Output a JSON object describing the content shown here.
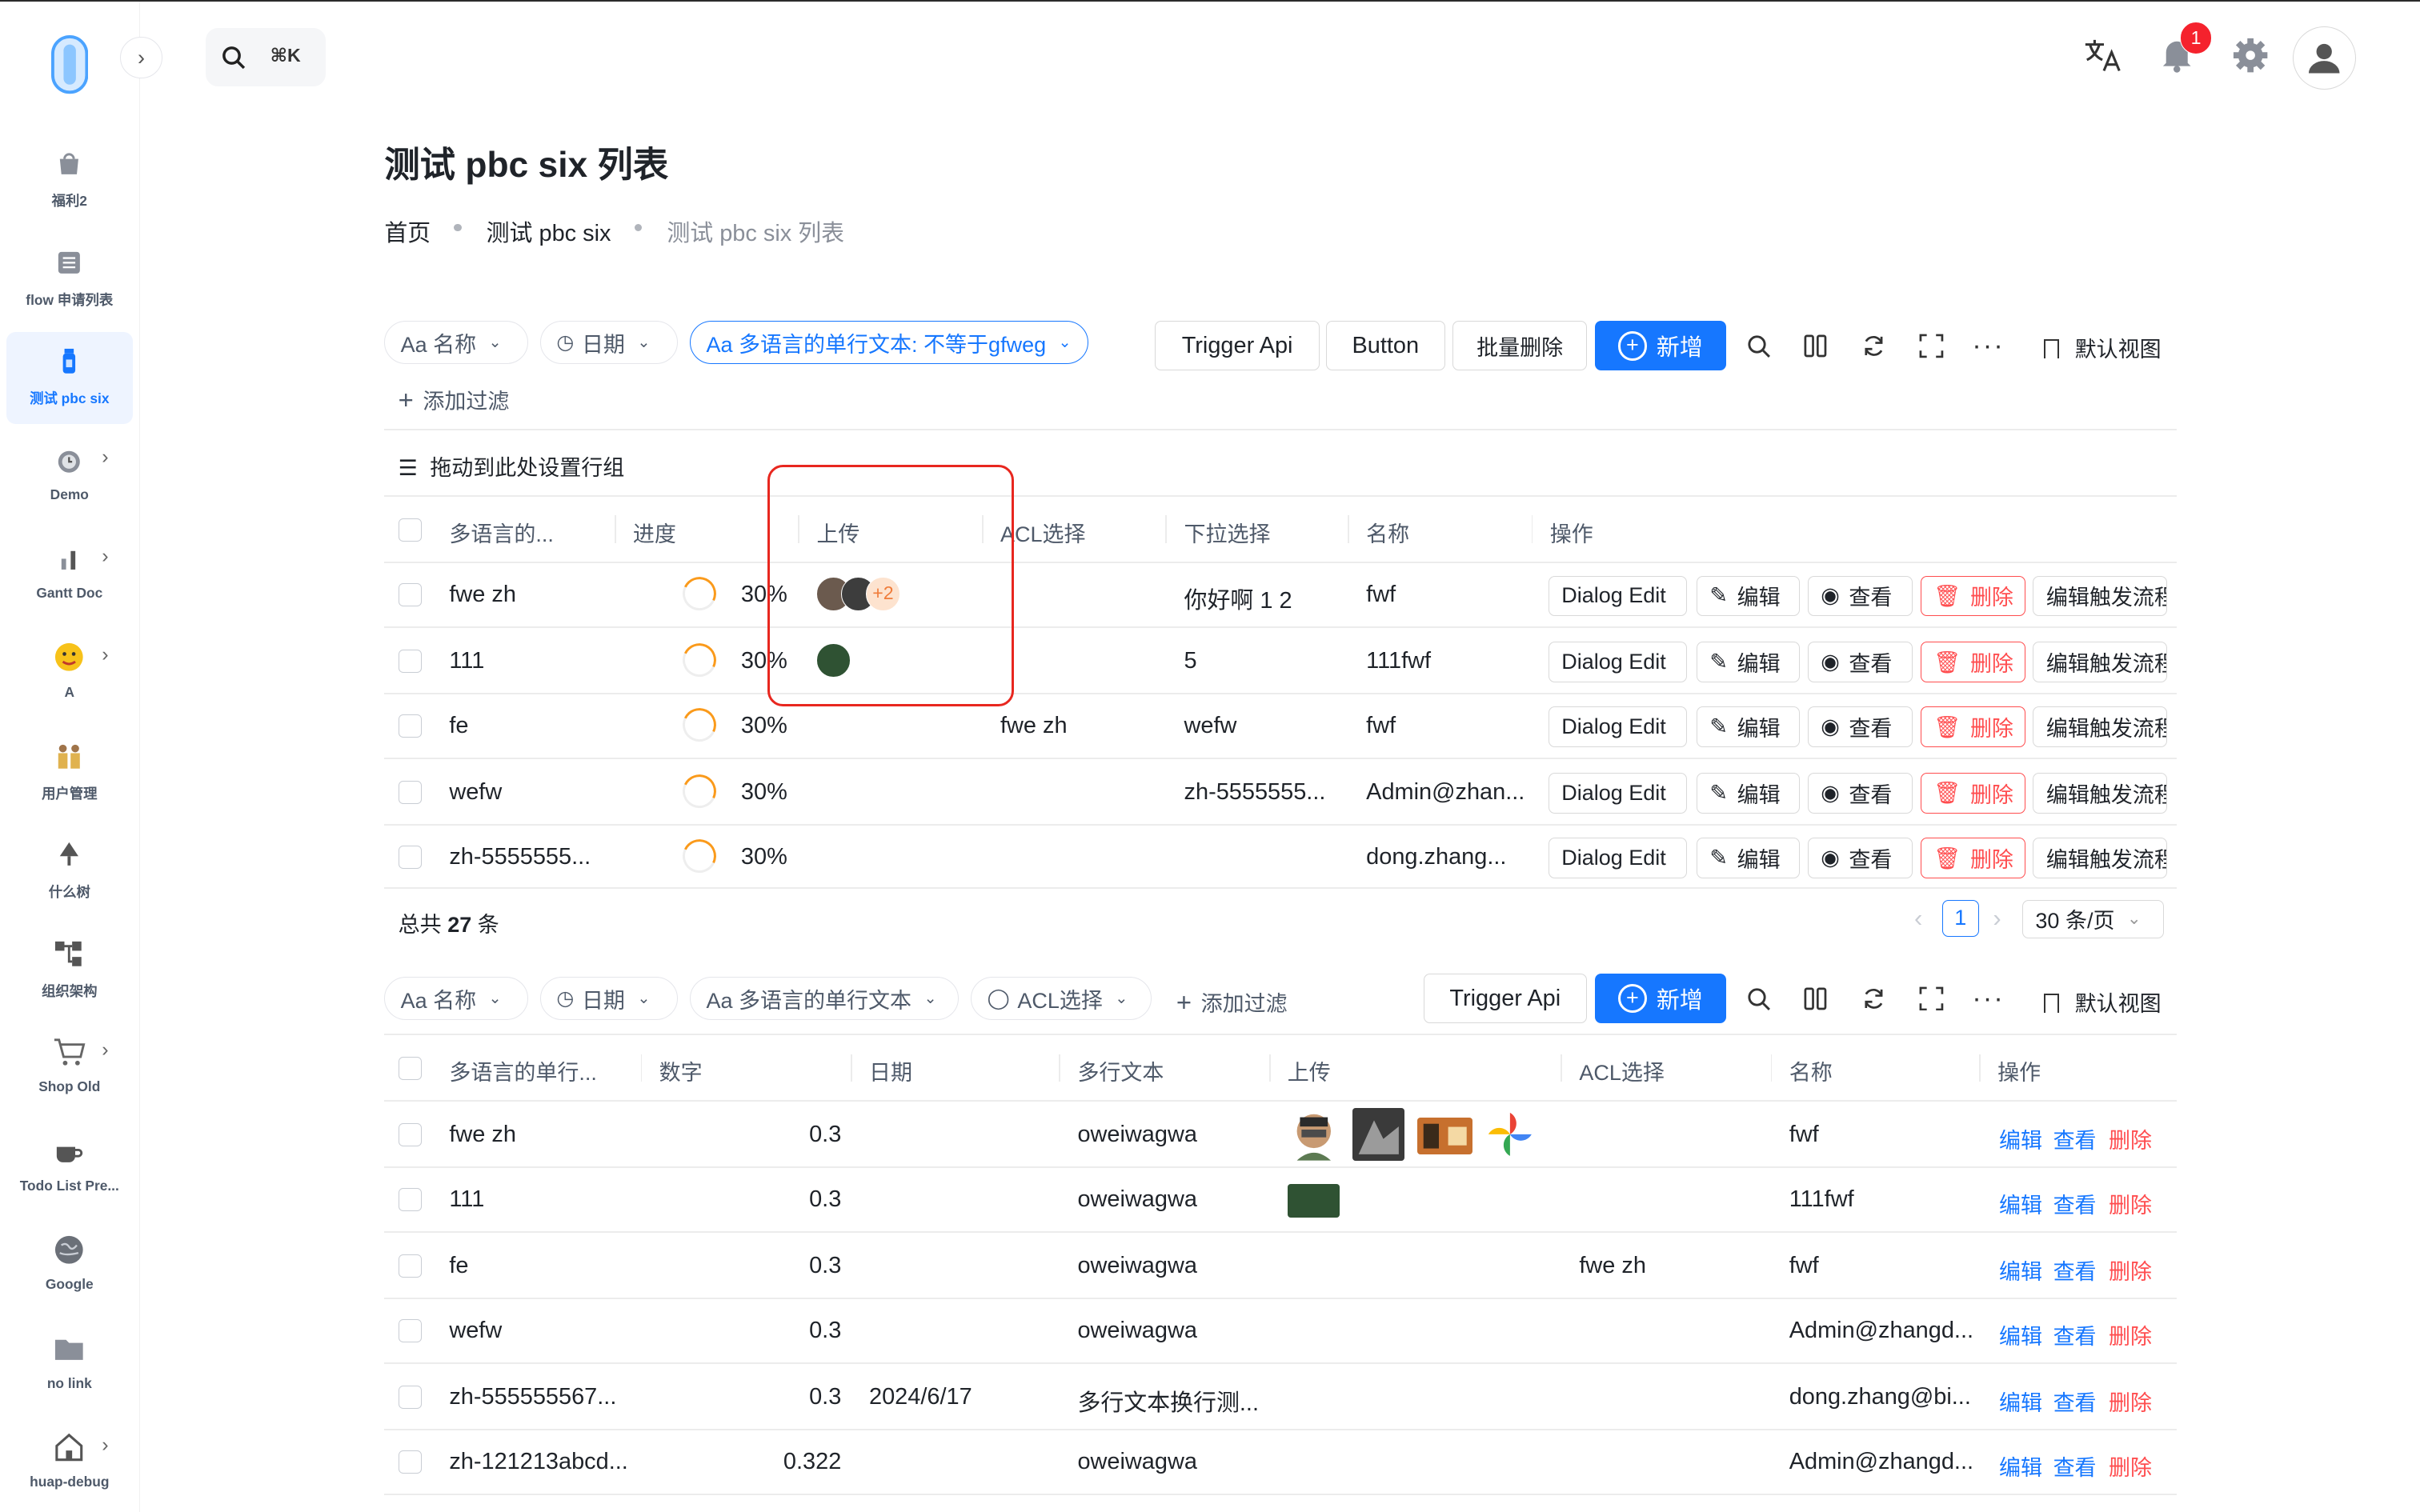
{
  "search": {
    "shortcut": "⌘K"
  },
  "topbar": {
    "notification_count": "1"
  },
  "sidebar": {
    "items": [
      {
        "label": "福利2"
      },
      {
        "label": "flow 申请列表"
      },
      {
        "label": "测试 pbc six"
      },
      {
        "label": "Demo"
      },
      {
        "label": "Gantt Doc"
      },
      {
        "label": "A"
      },
      {
        "label": "用户管理"
      },
      {
        "label": "什么树"
      },
      {
        "label": "组织架构"
      },
      {
        "label": "Shop Old"
      },
      {
        "label": "Todo List Pre..."
      },
      {
        "label": "Google"
      },
      {
        "label": "no link"
      },
      {
        "label": "huap-debug"
      }
    ]
  },
  "page": {
    "title": "测试 pbc six 列表"
  },
  "breadcrumb": [
    "首页",
    "测试 pbc six",
    "测试 pbc six 列表"
  ],
  "table1": {
    "filters": [
      "Aa 名称",
      "日期",
      "Aa 多语言的单行文本: 不等于gfweg"
    ],
    "add_filter": "添加过滤",
    "buttons": {
      "trigger": "Trigger Api",
      "button": "Button",
      "batch_delete": "批量删除",
      "add": "新增",
      "view": "默认视图"
    },
    "group_hint": "拖动到此处设置行组",
    "columns": [
      "多语言的...",
      "进度",
      "上传",
      "ACL选择",
      "下拉选择",
      "名称",
      "操作"
    ],
    "rows": [
      {
        "text": "fwe zh",
        "progress": "30%",
        "progress_value": 0.3,
        "upload_more": "+2",
        "acl": "",
        "dropdown": "你好啊 1 2",
        "name": "fwf"
      },
      {
        "text": "111",
        "progress": "30%",
        "progress_value": 0.3,
        "upload_more": "",
        "acl": "",
        "dropdown": "5",
        "name": "111fwf"
      },
      {
        "text": "fe",
        "progress": "30%",
        "progress_value": 0.3,
        "upload_more": "",
        "acl": "fwe zh",
        "dropdown": "wefw",
        "name": "fwf"
      },
      {
        "text": "wefw",
        "progress": "30%",
        "progress_value": 0.3,
        "upload_more": "",
        "acl": "",
        "dropdown": "zh-5555555...",
        "name": "Admin@zhan..."
      },
      {
        "text": "zh-5555555...",
        "progress": "30%",
        "progress_value": 0.3,
        "upload_more": "",
        "acl": "",
        "dropdown": "",
        "name": "dong.zhang..."
      }
    ],
    "actions": {
      "dialog_edit": "Dialog Edit",
      "edit": "编辑",
      "view": "查看",
      "delete": "删除",
      "edit_flow": "编辑触发流程"
    },
    "total_prefix": "总共",
    "total_count": "27",
    "total_suffix": "条",
    "page": "1",
    "page_size": "30 条/页"
  },
  "table2": {
    "filters": [
      "Aa 名称",
      "日期",
      "Aa 多语言的单行文本",
      "ACL选择"
    ],
    "add_filter": "添加过滤",
    "buttons": {
      "trigger": "Trigger Api",
      "add": "新增",
      "view": "默认视图"
    },
    "columns": [
      "多语言的单行...",
      "数字",
      "日期",
      "多行文本",
      "上传",
      "ACL选择",
      "名称",
      "操作"
    ],
    "rows": [
      {
        "text": "fwe zh",
        "number": "0.3",
        "date": "",
        "multiline": "oweiwagwa",
        "acl": "",
        "name": "fwf"
      },
      {
        "text": "111",
        "number": "0.3",
        "date": "",
        "multiline": "oweiwagwa",
        "acl": "",
        "name": "111fwf"
      },
      {
        "text": "fe",
        "number": "0.3",
        "date": "",
        "multiline": "oweiwagwa",
        "acl": "fwe zh",
        "name": "fwf"
      },
      {
        "text": "wefw",
        "number": "0.3",
        "date": "",
        "multiline": "oweiwagwa",
        "acl": "",
        "name": "Admin@zhangd..."
      },
      {
        "text": "zh-555555567...",
        "number": "0.3",
        "date": "2024/6/17",
        "multiline": "多行文本换行测...",
        "acl": "",
        "name": "dong.zhang@bi..."
      },
      {
        "text": "zh-121213abcd...",
        "number": "0.322",
        "date": "",
        "multiline": "oweiwagwa",
        "acl": "",
        "name": "Admin@zhangd..."
      }
    ],
    "actions": {
      "edit": "编辑",
      "view": "查看",
      "delete": "删除"
    }
  }
}
